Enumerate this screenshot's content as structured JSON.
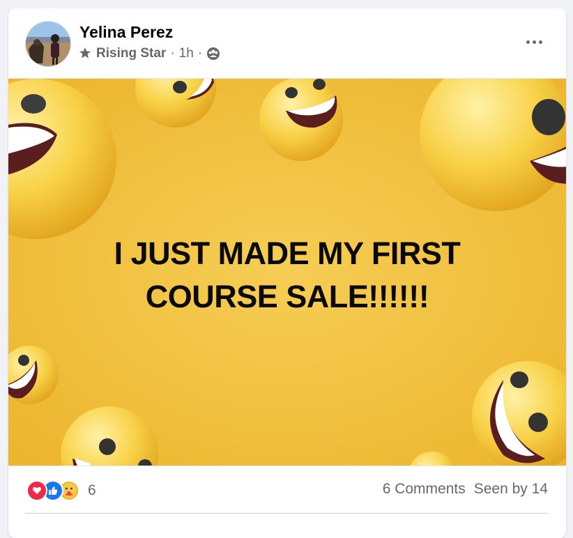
{
  "post": {
    "author": "Yelina Perez",
    "badge": "Rising Star",
    "separator": "·",
    "time": "1h",
    "audience_icon": "group-icon",
    "more_icon": "more-options-icon"
  },
  "media": {
    "text": "I JUST MADE MY FIRST COURSE SALE!!!!!!",
    "background_color": "#f2c13e"
  },
  "footer": {
    "reaction_icons": [
      "love-reaction-icon",
      "like-reaction-icon",
      "care-reaction-icon"
    ],
    "reaction_count": "6",
    "comments": "6 Comments",
    "seen": "Seen by 14"
  }
}
